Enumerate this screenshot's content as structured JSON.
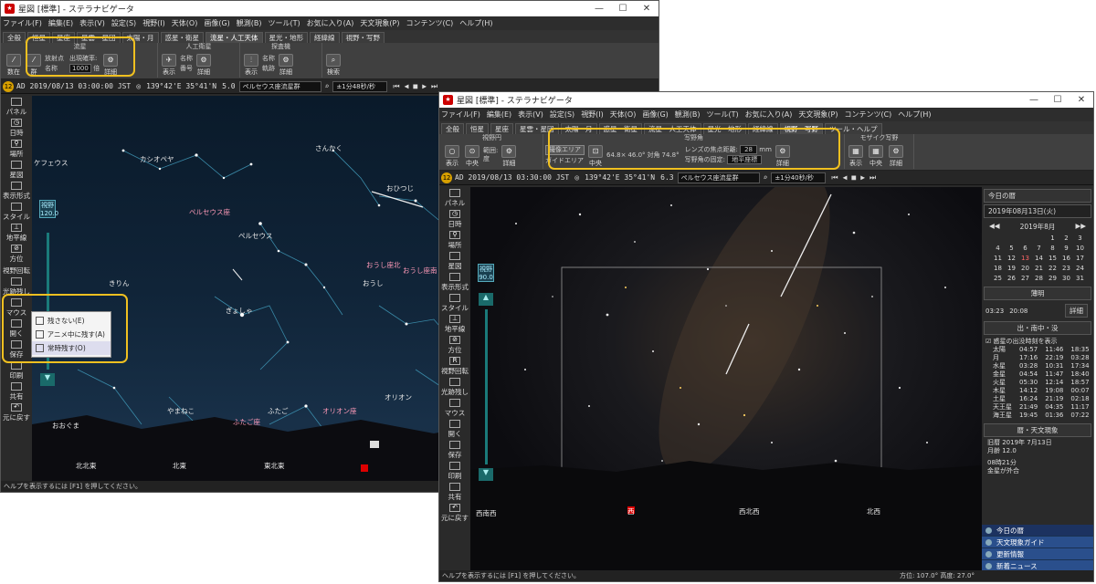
{
  "back": {
    "title": "星図 [標準] - ステラナビゲータ",
    "menu": [
      "ファイル(F)",
      "編集(E)",
      "表示(V)",
      "設定(S)",
      "視野(I)",
      "天体(O)",
      "画像(G)",
      "観測(B)",
      "ツール(T)",
      "お気に入り(A)",
      "天文現象(P)",
      "コンテンツ(C)",
      "ヘルプ(H)"
    ],
    "tabs": [
      "全般",
      "恒星",
      "星座",
      "星雲・星団",
      "太陽・月",
      "惑星・衛星",
      "流星・人工天体",
      "星光・地形",
      "経緯線",
      "視野・写野",
      "ツール・ヘルプ"
    ],
    "active_tab": 6,
    "ribbon": {
      "meteor_group": "流星",
      "artificial_group": "人工衛星",
      "probe_group": "探査機",
      "buttons": {
        "current": "数在",
        "group": "群",
        "radiant": "放射点",
        "name": "名称",
        "freq": "出現確率:",
        "freq_val": "1000",
        "freq_unit": "倍",
        "detail": "詳細",
        "show": "表示",
        "name2": "名称",
        "number": "番号",
        "show2": "表示",
        "detail2": "詳細",
        "name3": "名称",
        "orbit": "軌跡",
        "detail3": "詳細",
        "search": "検索"
      }
    },
    "status": {
      "date": "AD 2019/08/13 03:00:00 JST",
      "coord": "139°42'E 35°41'N",
      "fov": "5.0",
      "select": "ペルセウス座流星群",
      "speed": "±1分48秒/秒"
    },
    "side": [
      "パネル",
      "日時",
      "場所",
      "星図",
      "表示形式",
      "スタイル",
      "地平線",
      "方位",
      "視野回転",
      "光跡残し",
      "マウス",
      "開く",
      "保存",
      "印刷",
      "共有",
      "元に戻す"
    ],
    "fov_label": "視野",
    "fov_val": "120.0",
    "labels": {
      "cepheus": "ケフェウス",
      "cassiopeia": "カシオペヤ",
      "andromeda": "さんかく",
      "ouhitsuji": "おひつじ",
      "perseus_r": "ペルセウス座",
      "perseus": "ペルセウス",
      "kirin": "きりん",
      "orikita": "おうし座北",
      "orikan": "おうし座南",
      "oushi": "おうし",
      "gyosha": "ぎょしゃ",
      "orion": "オリオン",
      "orion_r": "オリオン座",
      "yamaneko": "やまねこ",
      "futago": "ふたご",
      "futago_r": "ふたご座",
      "ookuma": "おおぐま"
    },
    "horizon": [
      "北北東",
      "北東",
      "東北東"
    ],
    "ctx_menu": [
      "残さない(E)",
      "アニメ中に残す(A)",
      "常時残す(O)"
    ],
    "help": "ヘルプを表示するには [F1] を押してください。"
  },
  "front": {
    "title": "星図 [標準] - ステラナビゲータ",
    "menu": [
      "ファイル(F)",
      "編集(E)",
      "表示(V)",
      "設定(S)",
      "視野(I)",
      "天体(O)",
      "画像(G)",
      "観測(B)",
      "ツール(T)",
      "お気に入り(A)",
      "天文現象(P)",
      "コンテンツ(C)",
      "ヘルプ(H)"
    ],
    "tabs": [
      "全般",
      "恒星",
      "星座",
      "星雲・星団",
      "太陽・月",
      "惑星・衛星",
      "流星・人工天体",
      "星光・地形",
      "経緯線",
      "視野・写野",
      "ツール・ヘルプ"
    ],
    "active_tab": 9,
    "ribbon": {
      "view_group": "視野円",
      "photo_group": "写野角",
      "mosaic_group": "モザイク写野",
      "show": "表示",
      "center": "中央",
      "range": "範囲:",
      "deg": "度",
      "detail": "詳細",
      "area1": "撮像エリア",
      "area2": "ガイドエリア",
      "center2": "中央",
      "angle1": "64.8×",
      "angle2": "46.0°",
      "w": "対角",
      "wv": "74.8°",
      "focal": "レンズの焦点距離:",
      "focal_val": "28",
      "mm": "mm",
      "fix": "写野角の固定:",
      "fix_val": "地平座標",
      "show3": "表示",
      "center3": "中央",
      "detail3": "詳細"
    },
    "status": {
      "date": "AD 2019/08/13 03:30:00 JST",
      "coord": "139°42'E 35°41'N",
      "fov": "6.3",
      "select": "ペルセウス座流星群",
      "speed": "±1分40秒/秒"
    },
    "side": [
      "パネル",
      "日時",
      "場所",
      "星図",
      "表示形式",
      "スタイル",
      "地平線",
      "方位",
      "視野回転",
      "光跡残し",
      "マウス",
      "開く",
      "保存",
      "印刷",
      "共有",
      "元に戻す"
    ],
    "fov_label": "視野",
    "fov_val": "90.0",
    "horizon": [
      "西南西",
      "西",
      "西北西",
      "北西"
    ],
    "help": "ヘルプを表示するには [F1] を押してください。",
    "bottom_status": "方位: 107.0°  高度: 27.0°",
    "today": {
      "title": "今日の暦",
      "date": "2019年08月13日(火)",
      "month": "2019年8月",
      "days": [
        "",
        "",
        "",
        "",
        "1",
        "2",
        "3",
        "4",
        "5",
        "6",
        "7",
        "8",
        "9",
        "10",
        "11",
        "12",
        "13",
        "14",
        "15",
        "16",
        "17",
        "18",
        "19",
        "20",
        "21",
        "22",
        "23",
        "24",
        "25",
        "26",
        "27",
        "28",
        "29",
        "30",
        "31"
      ],
      "twilight": "薄明",
      "tw_start": "03:23",
      "tw_end": "20:08",
      "detail": "詳細",
      "rise_hdr": "出・南中・没",
      "chk": "惑星の出没時刻を表示",
      "planets": [
        [
          "太陽",
          "04:57",
          "11:46",
          "18:35"
        ],
        [
          "月",
          "17:16",
          "22:19",
          "03:28"
        ],
        [
          "水星",
          "03:28",
          "10:31",
          "17:34"
        ],
        [
          "金星",
          "04:54",
          "11:47",
          "18:40"
        ],
        [
          "火星",
          "05:30",
          "12:14",
          "18:57"
        ],
        [
          "木星",
          "14:12",
          "19:08",
          "00:07"
        ],
        [
          "土星",
          "16:24",
          "21:19",
          "02:18"
        ],
        [
          "天王星",
          "21:49",
          "04:35",
          "11:17"
        ],
        [
          "海王星",
          "19:45",
          "01:36",
          "07:22"
        ]
      ],
      "event_hdr": "暦・天文現象",
      "lunar": "旧暦 2019年 7月13日",
      "moon_age": "月齢 12.0",
      "event": "08時21分",
      "event2": "金星が外合",
      "links": [
        "今日の暦",
        "天文現象ガイド",
        "更新情報",
        "新着ニュース"
      ]
    }
  }
}
